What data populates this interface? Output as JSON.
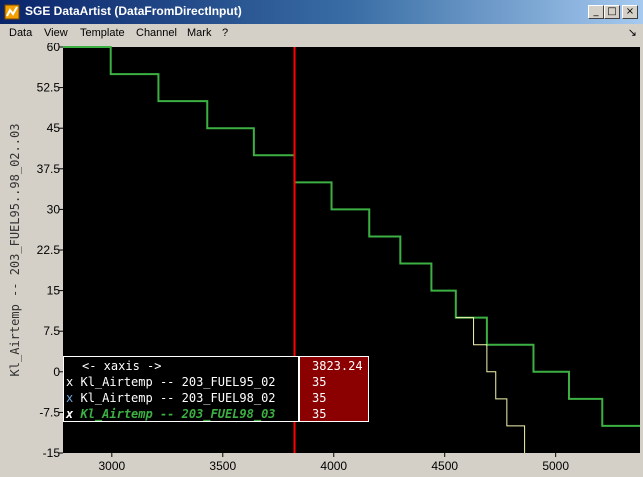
{
  "window": {
    "title": "SGE DataArtist (DataFromDirectInput)",
    "controls": {
      "minimize": "_",
      "maximize": "□",
      "close": "×"
    }
  },
  "menu": {
    "items": [
      "Data",
      "View",
      "Template",
      "Channel",
      "Mark",
      "?"
    ],
    "pin": "↘"
  },
  "colors": {
    "background": "#000000",
    "cursor": "#ff0000",
    "series_fuel95": "#3cb043",
    "series_fuel98": "#f5f5b0",
    "legend_x_active": "#ffffff",
    "legend_x_inactive": "#6fa8dc"
  },
  "chart_data": {
    "type": "line",
    "step": true,
    "ylabel": "Kl_Airtemp -- 203_FUEL95..98_02..03",
    "xlim": [
      2780,
      5380
    ],
    "ylim": [
      -15,
      60
    ],
    "xticks": [
      3000,
      3500,
      4000,
      4500,
      5000
    ],
    "yticks": [
      "60",
      "52.5",
      "45",
      "37.5",
      "30",
      "22.5",
      "15",
      "7.5",
      "0",
      "-7.5",
      "-15"
    ],
    "cursor_x": 3823.24,
    "series": [
      {
        "name": "Kl_Airtemp -- 203_FUEL95_02",
        "x": [
          2780,
          2995,
          3210,
          3430,
          3640,
          3823,
          3823,
          3990,
          4160,
          4300,
          4440,
          4550,
          4690,
          4900,
          5060,
          5210,
          5380
        ],
        "y": [
          60,
          55,
          50,
          45,
          40,
          40,
          35,
          30,
          25,
          20,
          15,
          10,
          5,
          0,
          -5,
          -10,
          -10
        ]
      },
      {
        "name": "Kl_Airtemp -- 203_FUEL98_02",
        "x": [
          4550,
          4630,
          4690,
          4730,
          4780,
          4860
        ],
        "y": [
          10,
          5,
          0,
          -5,
          -10,
          -15
        ]
      },
      {
        "name": "Kl_Airtemp -- 203_FUEL98_03",
        "x": [],
        "y": []
      }
    ]
  },
  "legend": {
    "header": "<- xaxis ->",
    "cursor_value": "3823.24",
    "rows": [
      {
        "mark": "x",
        "label": "Kl_Airtemp -- 203_FUEL95_02",
        "value": "35"
      },
      {
        "mark": "x",
        "label": "Kl_Airtemp -- 203_FUEL98_02",
        "value": "35"
      },
      {
        "mark": "x",
        "label": "Kl_Airtemp -- 203_FUEL98_03",
        "value": "35"
      }
    ]
  }
}
